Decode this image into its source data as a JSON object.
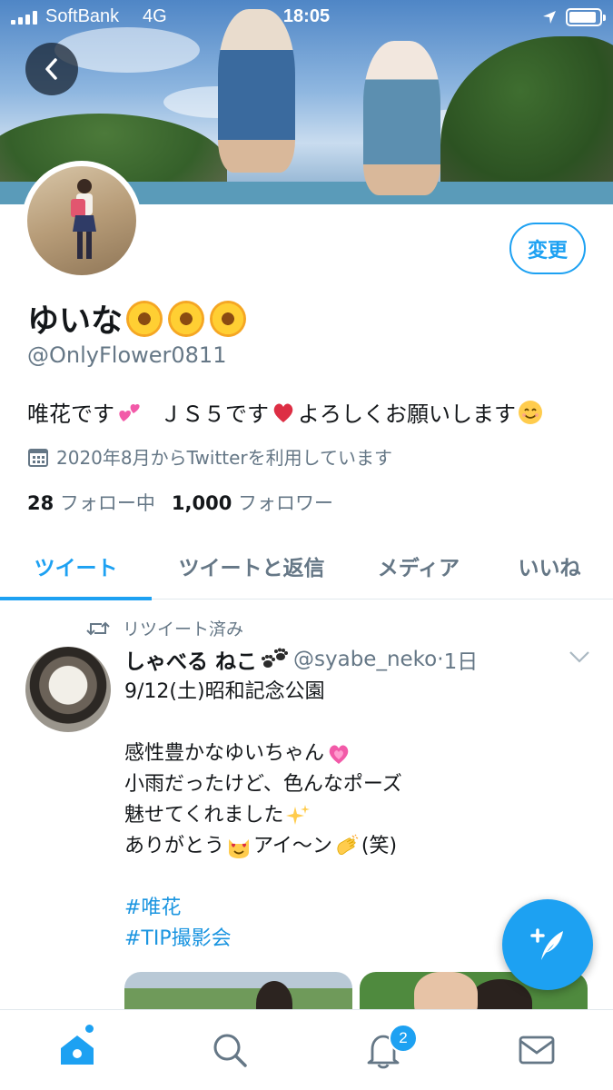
{
  "status_bar": {
    "carrier": "SoftBank",
    "network": "4G",
    "time": "18:05",
    "battery_level": 0.9
  },
  "profile": {
    "display_name": "ゆいな",
    "name_emoji": "sunflower",
    "handle": "@OnlyFlower0811",
    "edit_label": "変更",
    "bio_parts": [
      "唯花です",
      "ＪＳ５です",
      "よろしくお願いします"
    ],
    "joined": "2020年8月からTwitterを利用しています",
    "following_count": "28",
    "following_label": "フォロー中",
    "followers_count": "1,000",
    "followers_label": "フォロワー"
  },
  "tabs": [
    {
      "label": "ツイート",
      "active": true
    },
    {
      "label": "ツイートと返信",
      "active": false
    },
    {
      "label": "メディア",
      "active": false
    },
    {
      "label": "いいね",
      "active": false
    }
  ],
  "tweet": {
    "retweet_label": "リツイート済み",
    "author_name": "しゃべる ねこ",
    "author_handle": "@syabe_neko",
    "separator": "·",
    "time_ago": "1日",
    "lines": {
      "l1": "9/12(土)昭和記念公園",
      "l2": "感性豊かなゆいちゃん",
      "l3": "小雨だったけど、色んなポーズ",
      "l4": "魅せてくれました",
      "l5a": "ありがとう",
      "l5b": "アイ～ン",
      "l5c": "(笑)",
      "h1": "#唯花",
      "h2": "#TIP撮影会"
    }
  },
  "nav": {
    "notifications_badge": "2"
  },
  "colors": {
    "accent": "#1da1f2",
    "secondary_text": "#657786",
    "hashtag": "#1b95e0"
  },
  "icons": [
    "back-arrow-icon",
    "calendar-icon",
    "retweet-icon",
    "chevron-down-icon",
    "compose-icon",
    "home-icon",
    "search-icon",
    "bell-icon",
    "mail-icon"
  ]
}
